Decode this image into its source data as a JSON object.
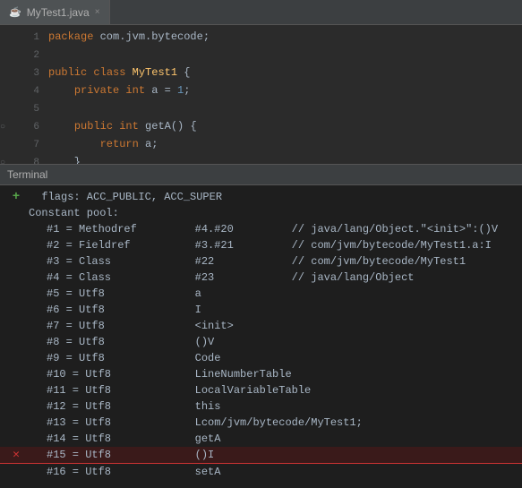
{
  "tab": {
    "icon": "☕",
    "label": "MyTest1.java",
    "close": "×"
  },
  "editor": {
    "lines": [
      {
        "num": "1",
        "gutter": "",
        "tokens": [
          {
            "t": "kw",
            "v": "package "
          },
          {
            "t": "plain",
            "v": "com.jvm.bytecode;"
          }
        ]
      },
      {
        "num": "2",
        "gutter": "",
        "tokens": []
      },
      {
        "num": "3",
        "gutter": "",
        "tokens": [
          {
            "t": "kw",
            "v": "public "
          },
          {
            "t": "kw",
            "v": "class "
          },
          {
            "t": "classname",
            "v": "MyTest1"
          },
          {
            "t": "plain",
            "v": " {"
          }
        ]
      },
      {
        "num": "4",
        "gutter": "",
        "tokens": [
          {
            "t": "plain",
            "v": "    "
          },
          {
            "t": "kw",
            "v": "private "
          },
          {
            "t": "kw",
            "v": "int "
          },
          {
            "t": "plain",
            "v": "a = "
          },
          {
            "t": "num",
            "v": "1"
          },
          {
            "t": "plain",
            "v": ";"
          }
        ]
      },
      {
        "num": "5",
        "gutter": "",
        "tokens": []
      },
      {
        "num": "6",
        "gutter": "○",
        "tokens": [
          {
            "t": "plain",
            "v": "    "
          },
          {
            "t": "kw",
            "v": "public "
          },
          {
            "t": "kw",
            "v": "int "
          },
          {
            "t": "plain",
            "v": "getA() {"
          }
        ]
      },
      {
        "num": "7",
        "gutter": "",
        "tokens": [
          {
            "t": "plain",
            "v": "        "
          },
          {
            "t": "kw",
            "v": "return "
          },
          {
            "t": "plain",
            "v": "a;"
          }
        ]
      },
      {
        "num": "8",
        "gutter": "○",
        "tokens": [
          {
            "t": "plain",
            "v": "    }"
          }
        ]
      }
    ]
  },
  "divider": {
    "label": "Terminal"
  },
  "terminal": {
    "lines": [
      {
        "gutter": "add",
        "indent": false,
        "text": "  flags: ACC_PUBLIC, ACC_SUPER"
      },
      {
        "gutter": "",
        "indent": false,
        "text": "Constant pool:"
      },
      {
        "gutter": "",
        "indent": true,
        "text": "#1 = Methodref         #4.#20         // java/lang/Object.\"<init>\":()V"
      },
      {
        "gutter": "",
        "indent": true,
        "text": "#2 = Fieldref          #3.#21         // com/jvm/bytecode/MyTest1.a:I"
      },
      {
        "gutter": "",
        "indent": true,
        "text": "#3 = Class             #22            // com/jvm/bytecode/MyTest1"
      },
      {
        "gutter": "",
        "indent": true,
        "text": "#4 = Class             #23            // java/lang/Object"
      },
      {
        "gutter": "",
        "indent": true,
        "text": "#5 = Utf8              a"
      },
      {
        "gutter": "",
        "indent": true,
        "text": "#6 = Utf8              I"
      },
      {
        "gutter": "",
        "indent": true,
        "text": "#7 = Utf8              <init>"
      },
      {
        "gutter": "",
        "indent": true,
        "text": "#8 = Utf8              ()V"
      },
      {
        "gutter": "",
        "indent": true,
        "text": "#9 = Utf8              Code"
      },
      {
        "gutter": "",
        "indent": true,
        "text": "#10 = Utf8             LineNumberTable"
      },
      {
        "gutter": "",
        "indent": true,
        "text": "#11 = Utf8             LocalVariableTable"
      },
      {
        "gutter": "",
        "indent": true,
        "text": "#12 = Utf8             this"
      },
      {
        "gutter": "",
        "indent": true,
        "text": "#13 = Utf8             Lcom/jvm/bytecode/MyTest1;"
      },
      {
        "gutter": "",
        "indent": true,
        "text": "#14 = Utf8             getA"
      },
      {
        "gutter": "x",
        "indent": true,
        "text": "#15 = Utf8             ()I",
        "highlight": true
      },
      {
        "gutter": "",
        "indent": true,
        "text": "#16 = Utf8             setA"
      }
    ]
  }
}
